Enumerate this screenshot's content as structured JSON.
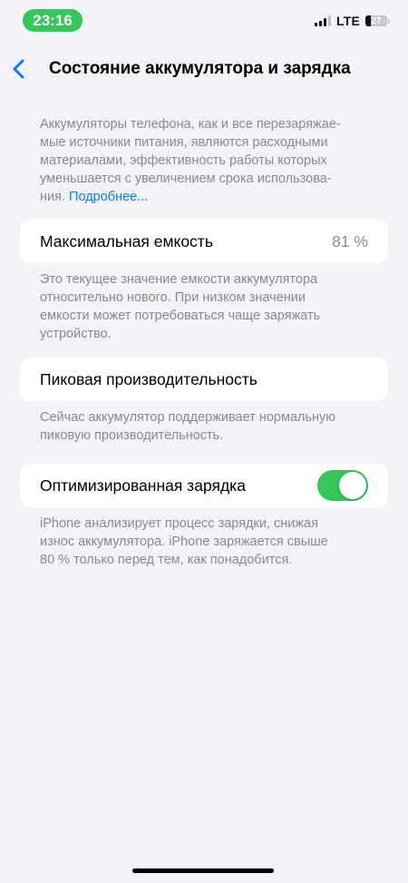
{
  "status_bar": {
    "time": "23:16",
    "network": "LTE",
    "battery_level": "27",
    "battery_fraction": 0.27,
    "accent_color": "#34c759"
  },
  "nav": {
    "back_icon": "chevron-left-icon",
    "title": "Состояние аккумулятора и зарядка"
  },
  "intro": {
    "lines": [
      "Аккумуляторы телефона, как и все перезаряжае-",
      "мые источники питания, являются расходными",
      "материалами, эффективность работы которых",
      "уменьшается с увеличением срока использова-"
    ],
    "last_line_prefix": "ния. ",
    "link_text": "Подробнее...",
    "link_color": "#0a7aff"
  },
  "max_capacity": {
    "label": "Максимальная емкость",
    "value": "81 %",
    "desc_lines": [
      "Это текущее значение емкости аккумулятора",
      "относительно нового. При низком значении",
      "емкости может потребоваться чаще заряжать",
      "устройство."
    ]
  },
  "peak_performance": {
    "label": "Пиковая производительность",
    "desc_lines": [
      "Сейчас аккумулятор поддерживает нормальную",
      "пиковую производительность."
    ]
  },
  "optimized_charging": {
    "label": "Оптимизированная зарядка",
    "enabled": true,
    "toggle_color": "#34c759",
    "desc_lines": [
      "iPhone анализирует процесс зарядки, снижая",
      "износ аккумулятора. iPhone заряжается свыше",
      "80 % только перед тем, как понадобится."
    ]
  }
}
